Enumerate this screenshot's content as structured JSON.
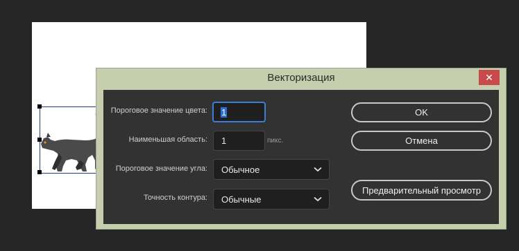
{
  "dialog": {
    "title": "Векторизация",
    "close_glyph": "✕"
  },
  "fields": {
    "color_threshold": {
      "label": "Пороговое значение цвета:",
      "value": "1"
    },
    "min_area": {
      "label": "Наименьшая область:",
      "value": "1",
      "unit": "пикс."
    },
    "angle_threshold": {
      "label": "Пороговое значение угла:",
      "value": "Обычное"
    },
    "curve_fit": {
      "label": "Точность контура:",
      "value": "Обычные"
    }
  },
  "buttons": {
    "ok": "OK",
    "cancel": "Отмена",
    "preview": "Предварительный просмотр"
  },
  "colors": {
    "dialog_frame": "#c5cfad",
    "panel": "#323232",
    "focus_accent": "#3b7fd6",
    "close_red": "#c94a4a"
  }
}
